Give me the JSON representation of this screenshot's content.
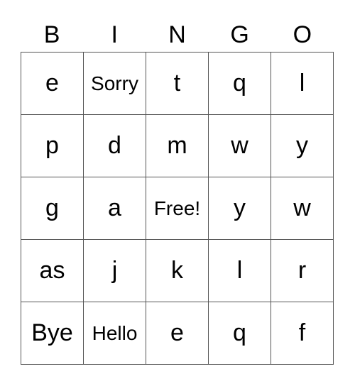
{
  "header": [
    "B",
    "I",
    "N",
    "G",
    "O"
  ],
  "rows": [
    [
      "e",
      "Sorry",
      "t",
      "q",
      "l"
    ],
    [
      "p",
      "d",
      "m",
      "w",
      "y"
    ],
    [
      "g",
      "a",
      "Free!",
      "y",
      "w"
    ],
    [
      "as",
      "j",
      "k",
      "l",
      "r"
    ],
    [
      "Bye",
      "Hello",
      "e",
      "q",
      "f"
    ]
  ]
}
